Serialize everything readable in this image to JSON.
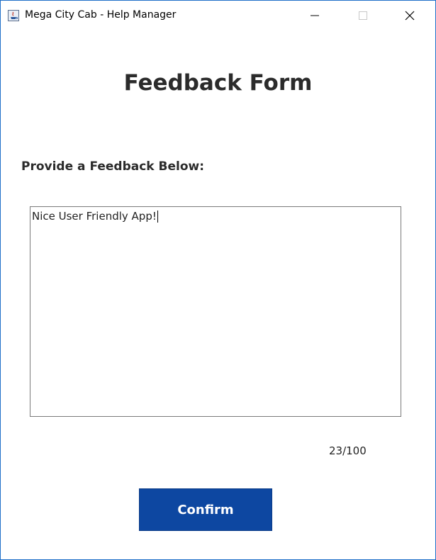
{
  "window": {
    "title": "Mega City Cab - Help Manager",
    "icon": "java-app-icon",
    "controls": [
      "minimize-icon",
      "maximize-icon",
      "close-icon"
    ]
  },
  "form": {
    "heading": "Feedback Form",
    "label": "Provide a Feedback Below:",
    "feedback_value": "Nice User Friendly App!",
    "char_counter": "23/100",
    "confirm_label": "Confirm"
  },
  "colors": {
    "window_border": "#1f6fc8",
    "button_bg": "#0d47a1",
    "button_text": "#ffffff",
    "heading_text": "#2b2b2b"
  }
}
